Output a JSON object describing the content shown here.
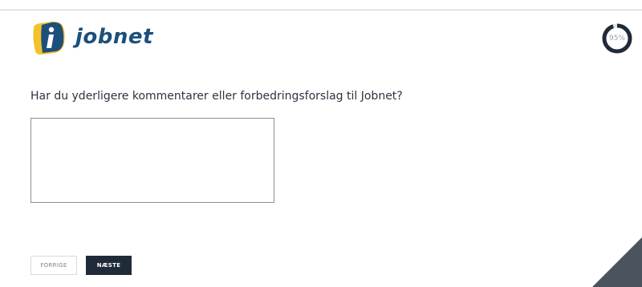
{
  "header": {
    "logo_text": "jobnet",
    "progress_label": "95%",
    "progress_value": 0.95
  },
  "survey": {
    "question": "Har du yderligere kommentarer eller forbedringsforslag til Jobnet?",
    "comment_value": ""
  },
  "navigation": {
    "prev_label": "FORRIGE",
    "next_label": "NÆSTE"
  },
  "colors": {
    "brand_blue": "#1c4f7c",
    "brand_yellow": "#f2c12e",
    "dark_navy": "#1f2b38",
    "progress_track": "#e4e6e8"
  },
  "icons": {
    "logo": "jobnet-logo-icon",
    "progress": "progress-ring-icon",
    "corner": "corner-decoration-icon"
  }
}
